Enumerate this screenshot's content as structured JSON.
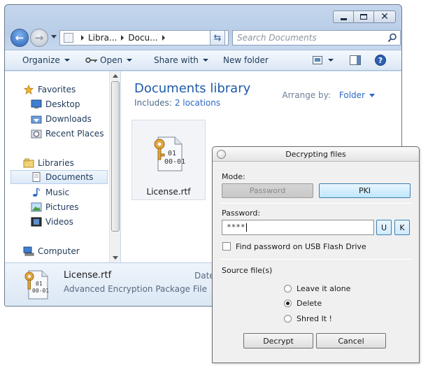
{
  "explorer": {
    "address": {
      "crumbs": [
        "Libra...",
        "Docu..."
      ]
    },
    "search": {
      "placeholder": "Search Documents"
    },
    "toolbar": {
      "organize": "Organize",
      "open": "Open",
      "share": "Share with",
      "new_folder": "New folder"
    },
    "nav": {
      "favorites": "Favorites",
      "desktop": "Desktop",
      "downloads": "Downloads",
      "recent": "Recent Places",
      "libraries": "Libraries",
      "documents": "Documents",
      "music": "Music",
      "pictures": "Pictures",
      "videos": "Videos",
      "computer": "Computer"
    },
    "content": {
      "title": "Documents library",
      "includes_label": "Includes:",
      "includes_link": "2 locations",
      "arrange_label": "Arrange by:",
      "arrange_value": "Folder",
      "file_name": "License.rtf"
    },
    "details": {
      "name": "License.rtf",
      "type": "Advanced Encryption Package File",
      "date_label": "Date"
    }
  },
  "dialog": {
    "title": "Decrypting files",
    "mode_label": "Mode:",
    "mode_password": "Password",
    "mode_pki": "PKI",
    "password_label": "Password:",
    "password_value": "****",
    "u_button": "U",
    "k_button": "K",
    "usb_checkbox": "Find password on USB Flash Drive",
    "source_label": "Source file(s)",
    "options": [
      "Leave it alone",
      "Delete",
      "Shred It !"
    ],
    "selected_option": "Delete",
    "decrypt_button": "Decrypt",
    "cancel_button": "Cancel"
  }
}
